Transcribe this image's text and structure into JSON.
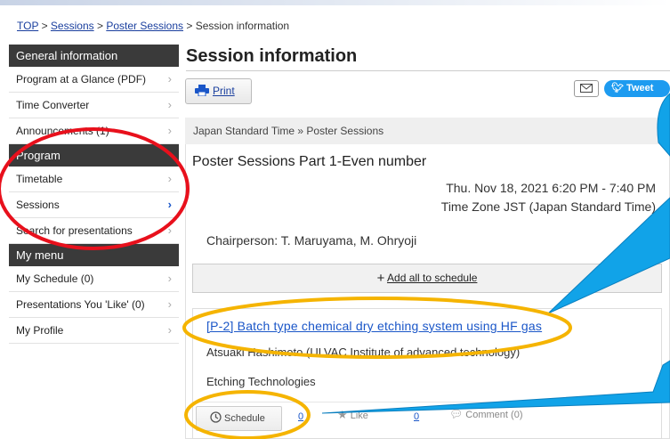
{
  "breadcrumb": {
    "top": "TOP",
    "sessions": "Sessions",
    "poster_sessions": "Poster Sessions",
    "current": "Session information",
    "separator": ">"
  },
  "sidebar": {
    "sections": [
      {
        "header": "General information",
        "items": [
          "Program at a Glance (PDF)",
          "Time Converter",
          "Announcements (1)"
        ]
      },
      {
        "header": "Program",
        "items": [
          "Timetable",
          "Sessions",
          "Search for presentations"
        ]
      },
      {
        "header": "My menu",
        "items": [
          "My Schedule (0)",
          "Presentations You 'Like' (0)",
          "My Profile"
        ]
      }
    ],
    "chevron": "›",
    "active_item": "Sessions"
  },
  "main": {
    "title": "Session information",
    "print_label": "Print",
    "tweet_label": "Tweet",
    "timezone_bar": "Japan Standard Time   » Poster Sessions",
    "session_title": "Poster Sessions Part 1-Even number",
    "session_datetime": "Thu. Nov 18, 2021 6:20 PM - 7:40 PM",
    "session_timezone": "Time Zone JST (Japan Standard Time)",
    "chairperson": "Chairperson: T. Maruyama, M. Ohryoji",
    "add_all_label": "Add all to schedule",
    "add_all_icon": "+"
  },
  "presentation": {
    "title": "[P-2] Batch type chemical dry etching system using HF gas",
    "author": "Atsuaki Hashimoto (ULVAC Institute of advanced technology)",
    "topic": "Etching Technologies",
    "schedule_label": "Schedule",
    "schedule_count": "0",
    "like_label": "Like",
    "like_count": "0",
    "comment_label": "Comment (0)"
  },
  "colors": {
    "annotation_red": "#e8101c",
    "annotation_yellow": "#f5b400",
    "annotation_blue": "#11a3e8",
    "link_blue": "#1a56c8",
    "sidebar_header": "#3a3a3a",
    "tweet_blue": "#1d9bf0"
  },
  "icons": {
    "print": "printer-icon",
    "mail": "mail-icon",
    "tweet": "twitter-bird-icon",
    "schedule": "clock-icon",
    "like": "star-icon",
    "comment": "comment-icon"
  }
}
